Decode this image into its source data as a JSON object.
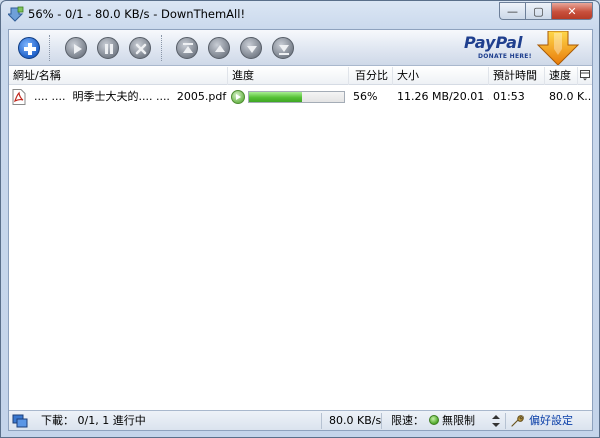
{
  "window": {
    "title": "56% - 0/1 - 80.0 KB/s - DownThemAll!",
    "controls": {
      "minimize": "—",
      "maximize": "▢",
      "close": "✕"
    }
  },
  "toolbar": {
    "buttons": [
      {
        "name": "add-download-button",
        "icon": "plus-icon",
        "state": "enabled"
      },
      {
        "name": "resume-button",
        "icon": "play-icon",
        "state": "disabled"
      },
      {
        "name": "pause-button",
        "icon": "pause-icon",
        "state": "disabled"
      },
      {
        "name": "cancel-button",
        "icon": "x-icon",
        "state": "disabled"
      },
      {
        "name": "move-top-button",
        "icon": "move-top-icon",
        "state": "disabled"
      },
      {
        "name": "move-up-button",
        "icon": "move-up-icon",
        "state": "disabled"
      },
      {
        "name": "move-down-button",
        "icon": "move-down-icon",
        "state": "disabled"
      },
      {
        "name": "move-bottom-button",
        "icon": "move-bottom-icon",
        "state": "disabled"
      }
    ],
    "paypal": {
      "brand": "PayPal",
      "sub": "DONATE HERE!"
    }
  },
  "table": {
    "columns": {
      "name": "網址/名稱",
      "progress": "進度",
      "percent": "百分比",
      "size": "大小",
      "eta": "預計時間",
      "speed": "速度"
    },
    "rows": [
      {
        "name": ".... ....  明季士大夫的.... ....  2005.pdf",
        "progress_fraction": 0.56,
        "percent": "56%",
        "size": "11.26 MB/20.01 ...",
        "eta": "01:53",
        "speed": "80.0 K..."
      }
    ]
  },
  "status": {
    "downloads": "下載： 0/1, 1 進行中",
    "speed": "80.0 KB/s",
    "limit_label": "限速：",
    "limit_value": "無限制",
    "preferences": "偏好設定"
  },
  "colors": {
    "accent_blue": "#2162c9",
    "progress_green": "#55c136",
    "close_red": "#c8503c"
  }
}
